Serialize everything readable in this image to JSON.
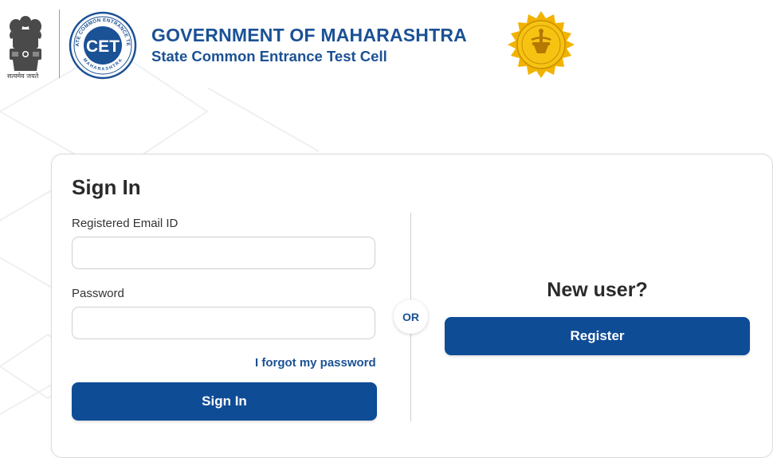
{
  "header": {
    "title": "GOVERNMENT OF MAHARASHTRA",
    "subtitle": "State Common Entrance Test Cell",
    "emblem_caption": "सत्यमेव जयते",
    "cet_logo_text": "CET",
    "cet_logo_ring_top": "STATE COMMON ENTRANCE TEST",
    "cet_logo_ring_bottom": "MAHARASHTRA"
  },
  "signin": {
    "heading": "Sign In",
    "email_label": "Registered Email ID",
    "email_value": "",
    "password_label": "Password",
    "password_value": "",
    "forgot_link": "I forgot my password",
    "submit_label": "Sign In"
  },
  "divider": {
    "or_label": "OR"
  },
  "register": {
    "heading": "New user?",
    "button_label": "Register"
  },
  "colors": {
    "brand_blue": "#1b5195",
    "button_blue": "#0f4c96",
    "seal_gold": "#f2b300"
  },
  "icons": {
    "emblem": "ashoka-emblem-icon",
    "cet_logo": "cet-logo-icon",
    "seal": "maharashtra-seal-icon"
  }
}
